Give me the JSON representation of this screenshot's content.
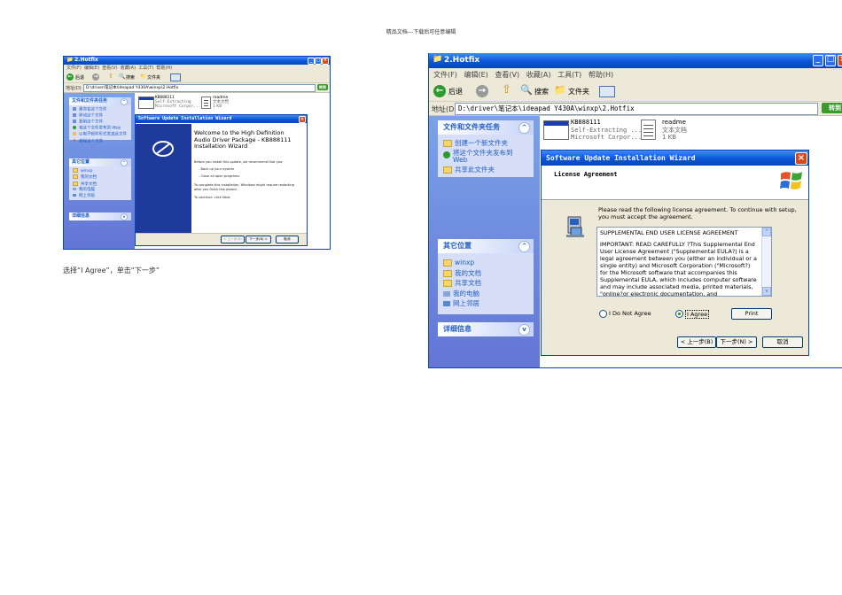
{
  "doc": {
    "header": "精品文档---下载后可任意编辑",
    "caption": "选择“I Agree”，单击“下一步”"
  },
  "left_window": {
    "title": "2.Hotfix",
    "menu": [
      "文件(F)",
      "编辑(E)",
      "查看(V)",
      "收藏(A)",
      "工具(T)",
      "帮助(H)"
    ],
    "toolbar": {
      "back": "后退",
      "search": "搜索",
      "folders": "文件夹"
    },
    "address_label": "地址(D)",
    "address": "D:\\driver\\笔记本\\ideapad Y430A\\winxp\\2.Hotfix",
    "go": "转到",
    "panels": [
      {
        "title": "文件和文件夹任务",
        "items": [
          "重命名这个文件",
          "移动这个文件",
          "复制这个文件",
          "将这个文件发布到 Web",
          "以电子邮件形式发送此文件",
          "删除这个文件"
        ]
      },
      {
        "title": "其它位置",
        "items": [
          "winxp",
          "我的文档",
          "共享文档",
          "我的电脑",
          "网上邻居"
        ]
      },
      {
        "title": "详细信息",
        "items": []
      }
    ],
    "files": [
      {
        "name": "KB888111",
        "lines": [
          "Self-Extracting",
          "Microsoft Corpor..."
        ]
      },
      {
        "name": "readme",
        "lines": [
          "文本文档",
          "1 KB"
        ]
      }
    ],
    "wizard": {
      "title": "Software Update Installation Wizard",
      "heading": "Welcome to the High Definition Audio Driver Package - KB888111 Installation Wizard",
      "para1": "Before you install this update, we recommend that you:",
      "bullet1": "- Back up your system",
      "bullet2": "- Close all open programs",
      "para2": "To complete this installation, Windows might require restarting after you finish this wizard.",
      "para3": "To continue, click Next.",
      "buttons": {
        "back": "< 上一步(B)",
        "next": "下一步(N) >",
        "cancel": "取消"
      }
    }
  },
  "right_window": {
    "title": "2.Hotfix",
    "menu": [
      "文件(F)",
      "编辑(E)",
      "查看(V)",
      "收藏(A)",
      "工具(T)",
      "帮助(H)"
    ],
    "toolbar": {
      "back": "后退",
      "search": "搜索",
      "folders": "文件夹"
    },
    "address_label": "地址(D)",
    "address": "D:\\driver\\笔记本\\ideapad Y430A\\winxp\\2.Hotfix",
    "go": "转到",
    "panels": [
      {
        "title": "文件和文件夹任务",
        "items": [
          "创建一个新文件夹",
          "将这个文件夹发布到 Web",
          "共享此文件夹"
        ]
      },
      {
        "title": "其它位置",
        "items": [
          "winxp",
          "我的文档",
          "共享文档",
          "我的电脑",
          "网上邻居"
        ]
      },
      {
        "title": "详细信息",
        "items": []
      }
    ],
    "files": [
      {
        "name": "KB888111",
        "lines": [
          "Self-Extracting ...",
          "Microsoft Corpor..."
        ]
      },
      {
        "name": "readme",
        "lines": [
          "文本文档",
          "1 KB"
        ]
      }
    ],
    "wizard": {
      "title": "Software Update Installation Wizard",
      "section": "License Agreement",
      "intro": "Please read the following license agreement. To continue with setup, you must accept the agreement.",
      "license_title": "SUPPLEMENTAL END USER LICENSE AGREEMENT",
      "license_body": "IMPORTANT: READ CAREFULLY ?This Supplemental End User License Agreement (\"Supplemental EULA?) is a legal agreement between you (either an individual or a single entity) and Microsoft Corporation (\"Microsoft?) for the Microsoft software that accompanies this Supplemental EULA, which includes computer software and may include associated media, printed materials, \"online?or electronic documentation, and",
      "options": {
        "disagree": "I Do Not Agree",
        "agree": "I Agree",
        "selected": "agree"
      },
      "print": "Print",
      "buttons": {
        "back": "< 上一步(B)",
        "next": "下一步(N) >",
        "cancel": "取消"
      }
    }
  }
}
